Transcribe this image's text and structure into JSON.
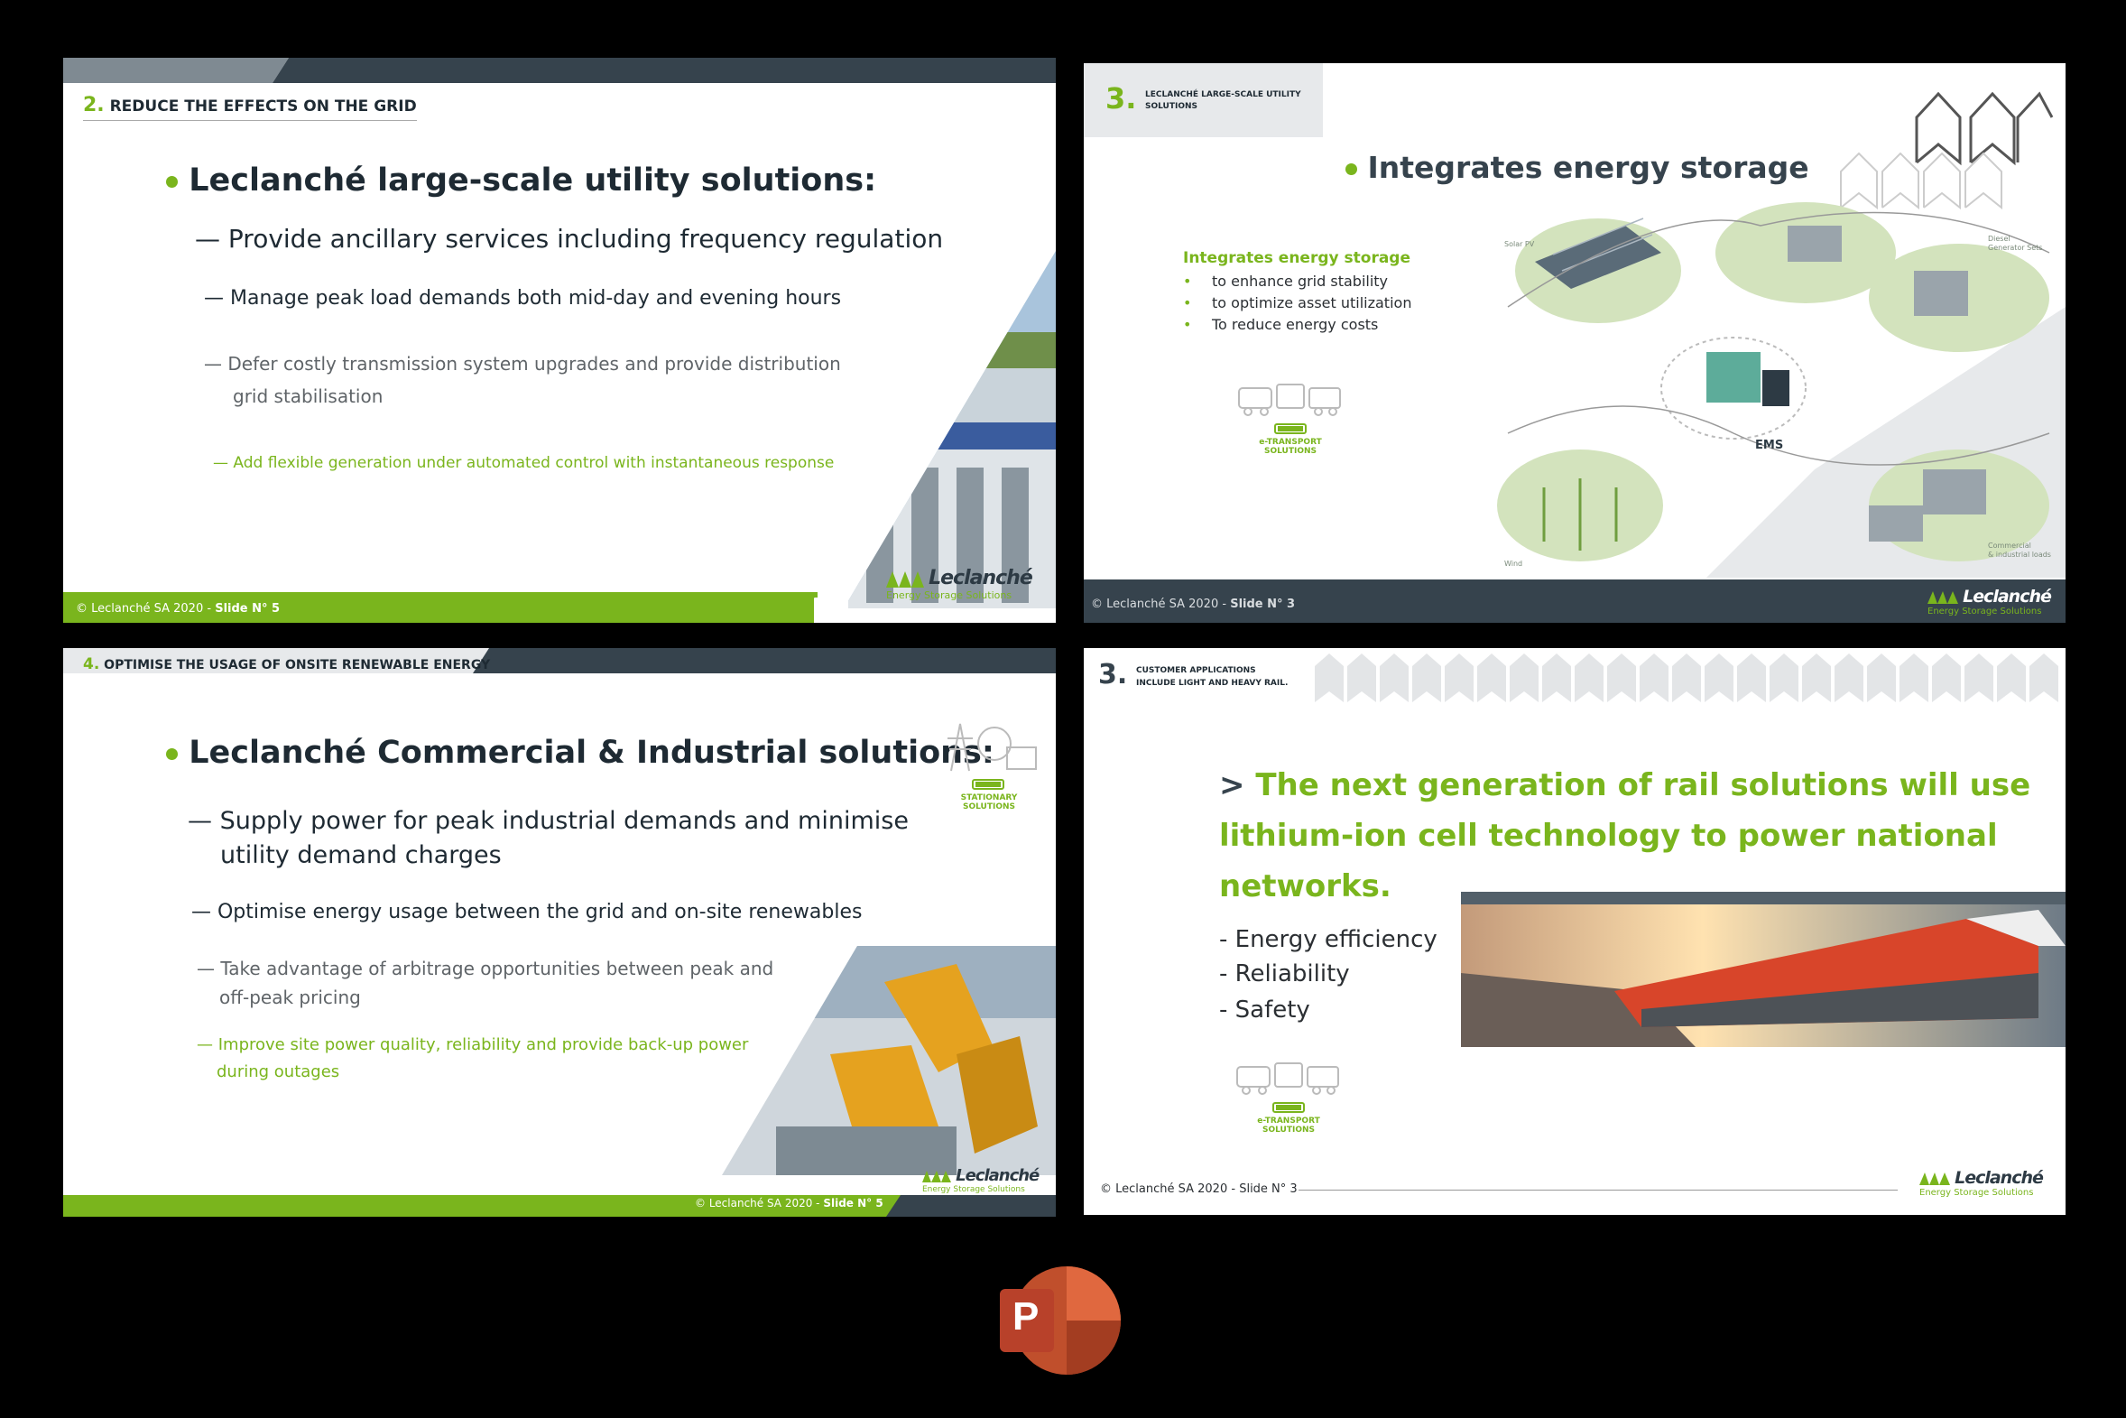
{
  "slides": [
    {
      "section_number": "2.",
      "section_title": "REDUCE THE EFFECTS ON THE GRID",
      "heading": "Leclanché large-scale utility solutions:",
      "points": [
        "— Provide ancillary services including frequency regulation",
        "— Manage peak load demands both mid-day and evening hours",
        "— Defer costly transmission system upgrades and provide distribution",
        "grid stabilisation",
        "— Add flexible generation under automated control with instantaneous response"
      ],
      "footer_copy": "© Leclanché SA 2020 -",
      "footer_slide": "Slide N° 5",
      "logo_name": "Leclanché",
      "logo_sub": "Energy Storage Solutions"
    },
    {
      "section_number": "3.",
      "section_title_1": "LECLANCHÉ LARGE-SCALE UTILITY",
      "section_title_2": "SOLUTIONS",
      "heading": "Integrates energy storage",
      "sub_heading": "Integrates energy storage",
      "points": [
        "to enhance grid stability",
        "to optimize asset utilization",
        "To reduce energy costs"
      ],
      "icon_caption_1": "e-TRANSPORT",
      "icon_caption_2": "SOLUTIONS",
      "diagram_labels": {
        "solar": "Solar PV",
        "diesel_1": "Diesel",
        "diesel_2": "Generator Sets",
        "ems": "EMS",
        "wind": "Wind",
        "commercial_1": "Commercial",
        "commercial_2": "& industrial loads"
      },
      "footer_copy": "© Leclanché SA 2020 -",
      "footer_slide": "Slide N° 3",
      "logo_name": "Leclanché",
      "logo_sub": "Energy Storage Solutions"
    },
    {
      "section_number": "4.",
      "section_title": "OPTIMISE THE USAGE OF ONSITE RENEWABLE ENERGY",
      "heading": "Leclanché Commercial & Industrial solutions:",
      "points": [
        "— Supply power for peak industrial demands and minimise",
        "utility demand charges",
        "— Optimise energy usage between the grid and on-site renewables",
        "— Take advantage of arbitrage opportunities between peak and",
        "off-peak pricing",
        "— Improve site power quality, reliability and provide back-up power",
        "during outages"
      ],
      "icon_caption_1": "STATIONARY",
      "icon_caption_2": "SOLUTIONS",
      "footer_copy": "© Leclanché SA 2020 -",
      "footer_slide": "Slide N° 5",
      "logo_name": "Leclanché",
      "logo_sub": "Energy Storage Solutions"
    },
    {
      "section_number": "3.",
      "section_title_1": "CUSTOMER APPLICATIONS",
      "section_title_2": "INCLUDE LIGHT AND HEAVY RAIL.",
      "heading_prefix": ">",
      "heading_lines": [
        "The next generation of rail solutions will use",
        "lithium-ion cell technology to power national",
        "networks."
      ],
      "points": [
        "- Energy efficiency",
        "- Reliability",
        "- Safety"
      ],
      "icon_caption_1": "e-TRANSPORT",
      "icon_caption_2": "SOLUTIONS",
      "footer_copy": "© Leclanché SA 2020 -",
      "footer_slide": "Slide N° 3",
      "logo_name": "Leclanché",
      "logo_sub": "Energy Storage Solutions"
    }
  ],
  "app_icon": {
    "name": "powerpoint-icon",
    "letter": "P"
  },
  "colors": {
    "accent_green": "#7ab51d",
    "dark_slate": "#36434d",
    "background": "#000000"
  }
}
